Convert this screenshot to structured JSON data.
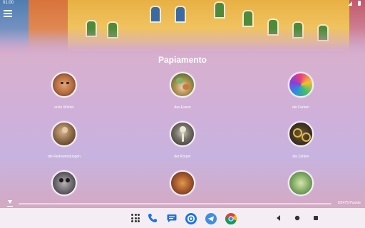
{
  "status_bar": {
    "time": "01:00"
  },
  "app": {
    "title": "Papiamento",
    "categories": [
      {
        "label": "erste Wörter",
        "icon": "child-face-image"
      },
      {
        "label": "das Essen",
        "icon": "food-plate-image"
      },
      {
        "label": "die Farben",
        "icon": "colors-image"
      },
      {
        "label": "die Redewendungen",
        "icon": "person-greeting-image"
      },
      {
        "label": "der Körper",
        "icon": "skeleton-image"
      },
      {
        "label": "die Zahlen",
        "icon": "numbers-image"
      },
      {
        "label": "",
        "icon": "animal-image"
      },
      {
        "label": "",
        "icon": "clothes-image"
      },
      {
        "label": "",
        "icon": "nature-image"
      }
    ],
    "progress": {
      "points_text": "0/2475 Punkte",
      "fraction": 0
    }
  },
  "navbar": {
    "apps": [
      "app-grid-icon",
      "phone-icon",
      "messages-icon",
      "settings-icon",
      "telegram-icon",
      "chrome-icon"
    ],
    "system": [
      "back-icon",
      "home-icon",
      "recents-icon"
    ]
  },
  "colors": {
    "accent": "#ffffff",
    "background": "#cfb0d9"
  }
}
